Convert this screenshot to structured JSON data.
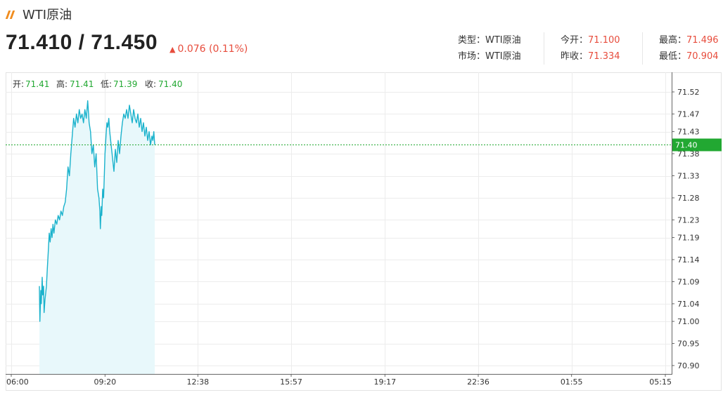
{
  "header": {
    "title": "WTI原油",
    "price": "71.410 / 71.450",
    "change": "0.076 (0.11%)",
    "change_arrow": "arrow-up-icon",
    "change_color": "#e74c3c"
  },
  "info": {
    "type_label": "类型：",
    "type_value": "WTI原油",
    "market_label": "市场：",
    "market_value": "WTI原油",
    "open_label": "今开：",
    "open_value": "71.100",
    "prev_close_label": "昨收：",
    "prev_close_value": "71.334",
    "high_label": "最高：",
    "high_value": "71.496",
    "low_label": "最低：",
    "low_value": "70.904"
  },
  "ohlc": {
    "open_label": "开:",
    "open_value": "71.41",
    "high_label": "高:",
    "high_value": "71.41",
    "low_label": "低:",
    "low_value": "71.39",
    "close_label": "收:",
    "close_value": "71.40"
  },
  "chart_data": {
    "type": "area",
    "y_ticks": [
      "71.52",
      "71.47",
      "71.43",
      "71.38",
      "71.33",
      "71.28",
      "71.23",
      "71.19",
      "71.14",
      "71.09",
      "71.04",
      "71.00",
      "70.95",
      "70.90"
    ],
    "x_ticks": [
      "06:00",
      "09:20",
      "12:38",
      "15:57",
      "19:17",
      "22:36",
      "01:55",
      "05:15"
    ],
    "ylim": [
      70.9,
      71.52
    ],
    "current_price": "71.40",
    "current_value": 71.4,
    "line_color": "#1ab2cc",
    "fill_color": "#e8f8fb",
    "price_tag_color": "#22a832",
    "x": [
      "07:00",
      "07:01",
      "07:03",
      "07:04",
      "07:06",
      "07:07",
      "07:09",
      "07:10",
      "07:12",
      "07:13",
      "07:15",
      "07:17",
      "07:19",
      "07:21",
      "07:23",
      "07:25",
      "07:27",
      "07:29",
      "07:31",
      "07:34",
      "07:37",
      "07:40",
      "07:43",
      "07:46",
      "07:49",
      "07:52",
      "07:55",
      "07:58",
      "08:01",
      "08:04",
      "08:07",
      "08:10",
      "08:13",
      "08:16",
      "08:19",
      "08:22",
      "08:25",
      "08:28",
      "08:31",
      "08:34",
      "08:37",
      "08:40",
      "08:43",
      "08:46",
      "08:49",
      "08:52",
      "08:55",
      "08:58",
      "09:01",
      "09:04",
      "09:07",
      "09:09",
      "09:10",
      "09:12",
      "09:13",
      "09:15",
      "09:17",
      "09:19",
      "09:20",
      "09:22",
      "09:24",
      "09:26",
      "09:28",
      "09:30",
      "09:33",
      "09:36",
      "09:39",
      "09:42",
      "09:45",
      "09:48",
      "09:51",
      "09:54",
      "09:57",
      "10:00",
      "10:03",
      "10:06",
      "10:09",
      "10:12",
      "10:15",
      "10:18",
      "10:21",
      "10:24",
      "10:27",
      "10:30",
      "10:33",
      "10:36",
      "10:39",
      "10:42",
      "10:45",
      "10:48",
      "10:51",
      "10:54",
      "10:57",
      "11:00",
      "11:02",
      "11:04",
      "11:06"
    ],
    "values": [
      71.08,
      71.0,
      71.07,
      71.04,
      71.1,
      71.06,
      71.08,
      71.02,
      71.05,
      71.06,
      71.08,
      71.12,
      71.16,
      71.2,
      71.18,
      71.21,
      71.19,
      71.22,
      71.2,
      71.23,
      71.22,
      71.24,
      71.23,
      71.25,
      71.24,
      71.26,
      71.27,
      71.3,
      71.35,
      71.33,
      71.38,
      71.42,
      71.46,
      71.44,
      71.47,
      71.45,
      71.48,
      71.46,
      71.47,
      71.45,
      71.48,
      71.46,
      71.5,
      71.45,
      71.43,
      71.38,
      71.4,
      71.35,
      71.38,
      71.3,
      71.28,
      71.25,
      71.21,
      71.26,
      71.24,
      71.3,
      71.28,
      71.35,
      71.38,
      71.42,
      71.45,
      71.44,
      71.46,
      71.43,
      71.4,
      71.37,
      71.34,
      71.39,
      71.36,
      71.41,
      71.38,
      71.42,
      71.45,
      71.47,
      71.46,
      71.48,
      71.46,
      71.49,
      71.47,
      71.45,
      71.48,
      71.46,
      71.45,
      71.47,
      71.44,
      71.46,
      71.43,
      71.45,
      71.42,
      71.44,
      71.41,
      71.43,
      71.4,
      71.42,
      71.41,
      71.43,
      71.4
    ]
  }
}
